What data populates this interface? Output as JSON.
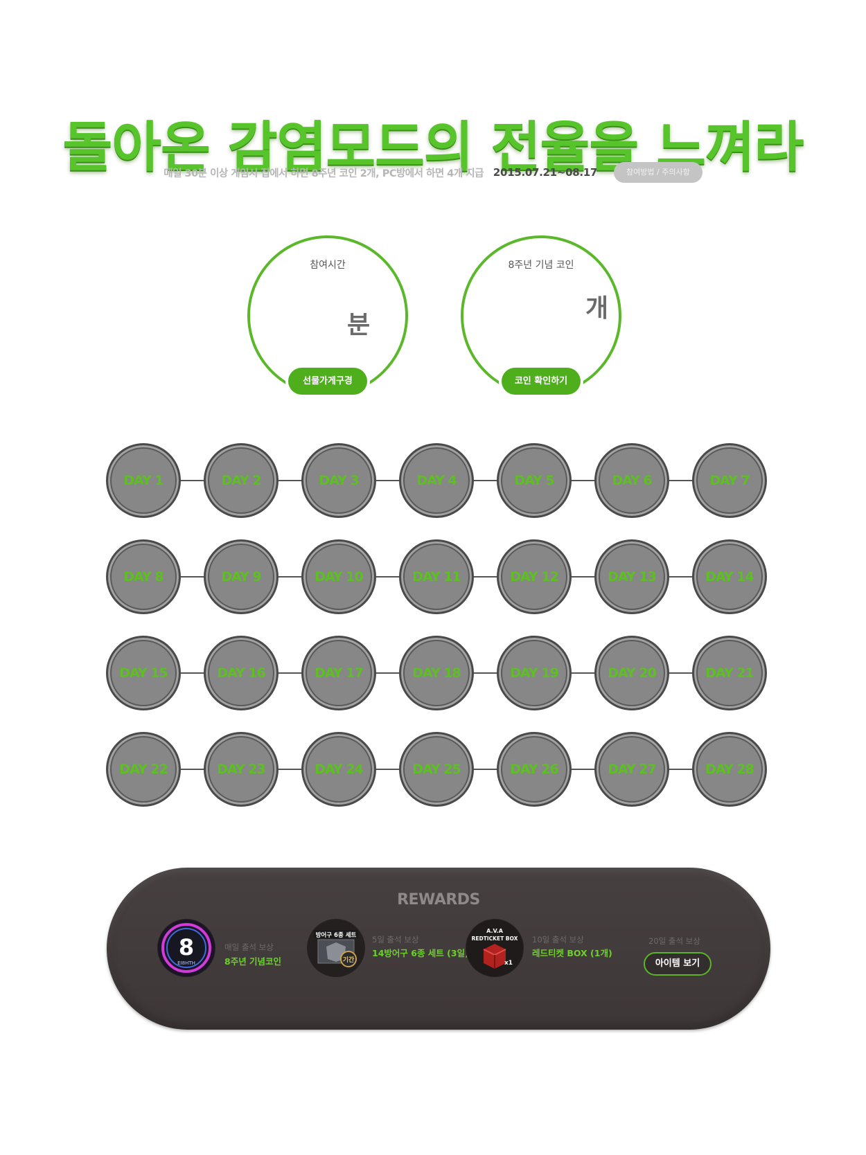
{
  "header": {
    "title": "돌아온 감염모드의 전율을 느껴라",
    "subtitle": "매일 30분 이상 게임시 집에서 하면 8주년 코인 2개, PC방에서 하면 4개 지급",
    "date_range": "2015.07.21~08.17",
    "notice_button": "참여방법 / 주의사항"
  },
  "stats": {
    "time": {
      "label": "참여시간",
      "unit": "분",
      "button": "선물가게구경"
    },
    "coin": {
      "label": "8주년 기념 코인",
      "unit": "개",
      "button": "코인 확인하기"
    }
  },
  "days": [
    [
      "DAY 1",
      "DAY 2",
      "DAY 3",
      "DAY 4",
      "DAY 5",
      "DAY 6",
      "DAY 7"
    ],
    [
      "DAY 8",
      "DAY 9",
      "DAY 10",
      "DAY 11",
      "DAY 12",
      "DAY 13",
      "DAY 14"
    ],
    [
      "DAY 15",
      "DAY 16",
      "DAY 17",
      "DAY 18",
      "DAY 19",
      "DAY 20",
      "DAY 21"
    ],
    [
      "DAY 22",
      "DAY 23",
      "DAY 24",
      "DAY 25",
      "DAY 26",
      "DAY 27",
      "DAY 28"
    ]
  ],
  "rewards": {
    "title": "REWARDS",
    "items": [
      {
        "caption": "매일 출석 보상",
        "name": "8주년 기념코인",
        "icon": "eighth-coin-icon",
        "icon_text": "8",
        "icon_sub": "EI8HTH"
      },
      {
        "caption": "5일 출석 보상",
        "name": "14방어구 6종 세트 (3일)",
        "icon": "armor-set-icon",
        "icon_text": "방어구 6종 세트",
        "badge": "기간"
      },
      {
        "caption": "10일 출석 보상",
        "name": "레드티켓 BOX (1개)",
        "icon": "red-ticket-box-icon",
        "icon_text": "A.V.A",
        "icon_sub": "REDTICKET BOX",
        "badge": "x1"
      }
    ],
    "extra": {
      "caption": "20일 출석 보상",
      "button": "아이템 보기"
    }
  },
  "colors": {
    "accent_green": "#5ab82a",
    "day_text": "#5dbf22",
    "day_fill": "#878787",
    "rewards_bg": "#423b3b"
  }
}
